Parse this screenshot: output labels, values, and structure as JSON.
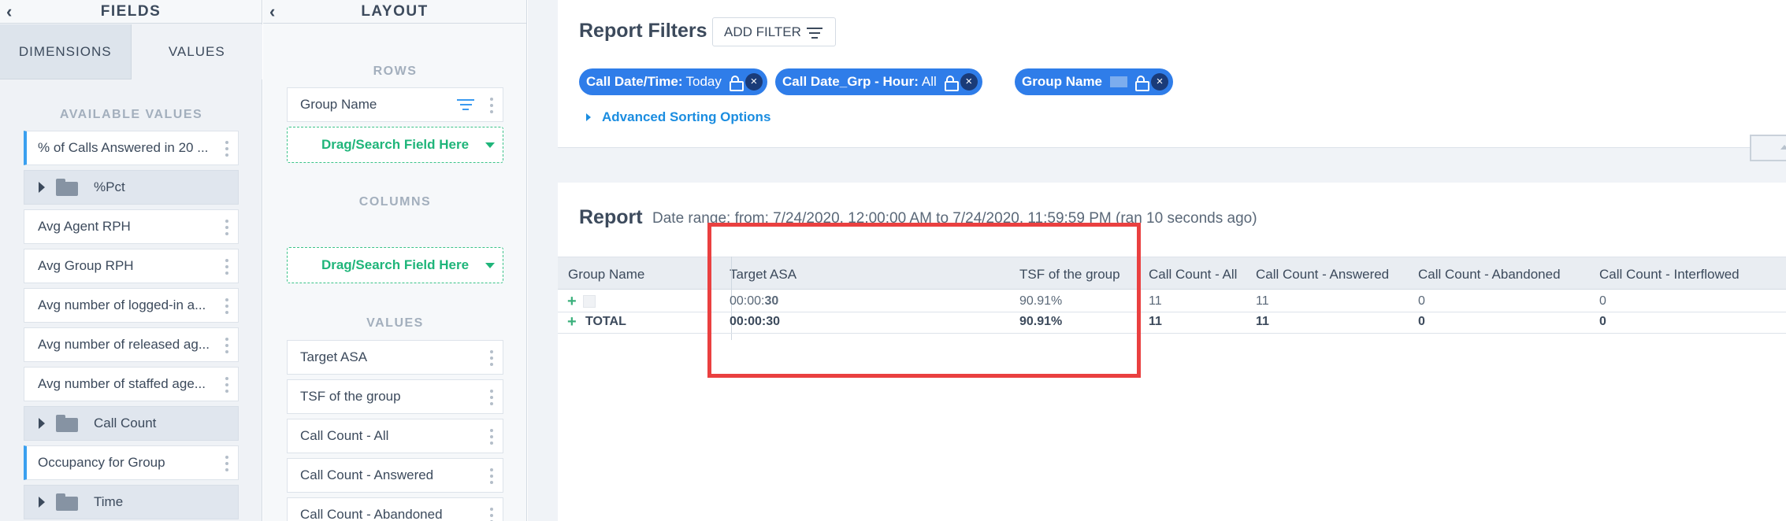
{
  "fields_panel": {
    "title": "FIELDS",
    "collapse_glyph": "‹",
    "tabs": [
      {
        "label": "DIMENSIONS",
        "active": false
      },
      {
        "label": "VALUES",
        "active": true
      }
    ],
    "section_label": "AVAILABLE VALUES",
    "items": [
      {
        "label": "% of Calls Answered in 20 ...",
        "type": "value",
        "accent": true
      },
      {
        "label": "%Pct",
        "type": "folder"
      },
      {
        "label": "Avg Agent RPH",
        "type": "value"
      },
      {
        "label": "Avg Group RPH",
        "type": "value"
      },
      {
        "label": "Avg number of logged-in a...",
        "type": "value"
      },
      {
        "label": "Avg number of released ag...",
        "type": "value"
      },
      {
        "label": "Avg number of staffed age...",
        "type": "value"
      },
      {
        "label": "Call Count",
        "type": "folder"
      },
      {
        "label": "Occupancy for Group",
        "type": "value",
        "accent": true
      },
      {
        "label": "Time",
        "type": "folder"
      }
    ]
  },
  "layout_panel": {
    "title": "LAYOUT",
    "collapse_glyph": "‹",
    "rows_label": "ROWS",
    "rows_items": [
      "Group Name"
    ],
    "columns_label": "COLUMNS",
    "values_label": "VALUES",
    "dropzone_label": "Drag/Search Field Here",
    "values_items": [
      "Target ASA",
      "TSF of the group",
      "Call Count - All",
      "Call Count - Answered",
      "Call Count - Abandoned"
    ]
  },
  "report_filters": {
    "title": "Report Filters",
    "add_filter_label": "ADD FILTER",
    "chips": [
      {
        "name": "Call Date/Time:",
        "value": "Today"
      },
      {
        "name": "Call Date_Grp - Hour:",
        "value": "All"
      },
      {
        "name": "Group Name",
        "value": ""
      }
    ],
    "advanced_sorting_label": "Advanced Sorting Options",
    "chip_color": "#2f7de9"
  },
  "report": {
    "title": "Report",
    "date_range": "Date range: from: 7/24/2020, 12:00:00 AM to 7/24/2020, 11:59:59 PM (ran 10 seconds ago)",
    "columns": [
      "Group Name",
      "Target ASA",
      "TSF of the group",
      "Call Count - All",
      "Call Count - Answered",
      "Call Count - Abandoned",
      "Call Count - Interflowed"
    ],
    "row": {
      "group_name": "",
      "target_asa_prefix": "00:00:",
      "target_asa_bold": "30",
      "tsf": "90.91%",
      "count_all": "11",
      "count_answered": "11",
      "count_abandoned": "0",
      "count_interflowed": "0"
    },
    "total": {
      "label": "TOTAL",
      "target_asa": "00:00:30",
      "tsf": "90.91%",
      "count_all": "11",
      "count_answered": "11",
      "count_abandoned": "0",
      "count_interflowed": "0"
    }
  },
  "icons": {
    "expand": "+",
    "remove": "×"
  },
  "highlight_color": "#ea4040"
}
